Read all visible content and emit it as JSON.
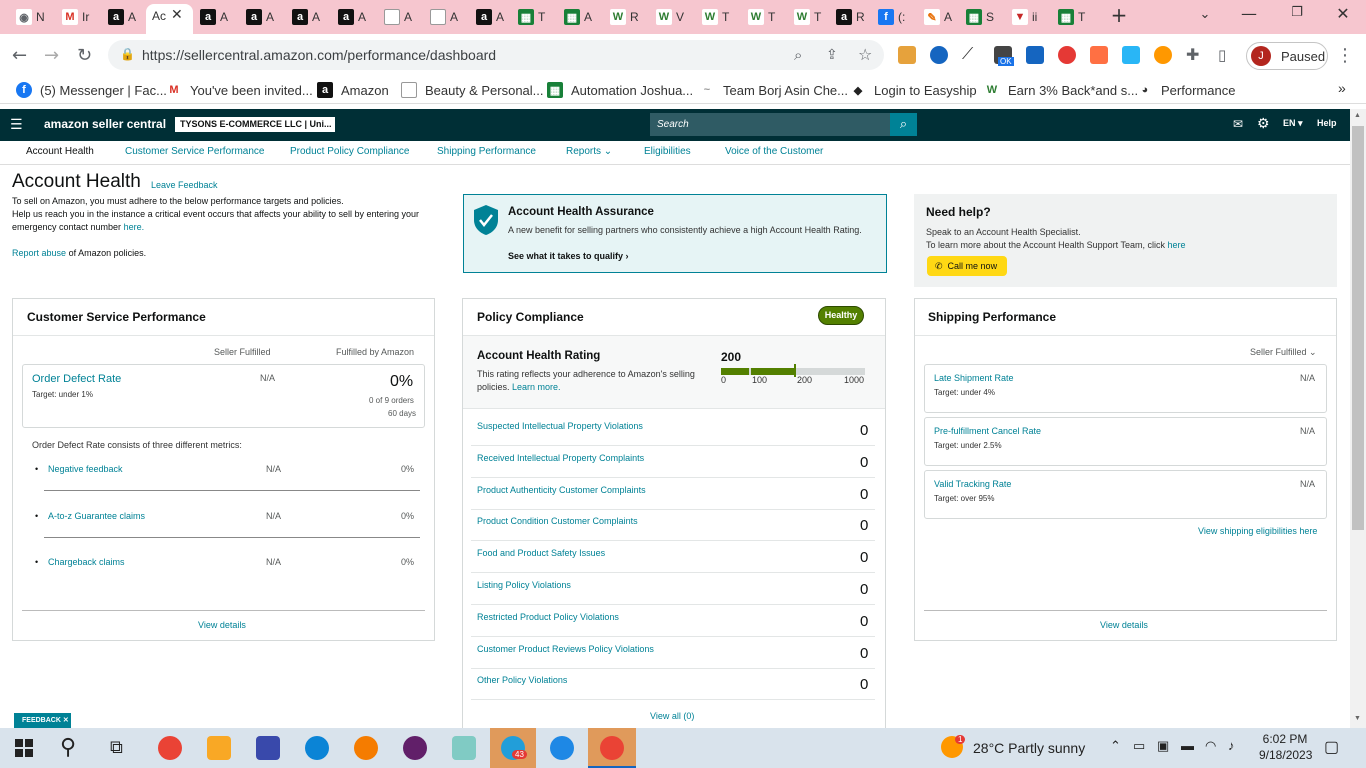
{
  "browser": {
    "tabs": [
      {
        "icon_name": "chrome-icon",
        "label": "N",
        "color": "#5f6368"
      },
      {
        "icon_name": "gmail-icon",
        "label": "Ir",
        "color": "#d93025"
      },
      {
        "icon_name": "amazon-icon",
        "label": "A",
        "color": "#111111"
      },
      {
        "icon_name": "amazon-icon",
        "label": "A",
        "color": "#111111"
      },
      {
        "icon_name": "amazon-icon",
        "label": "A",
        "color": "#111111"
      },
      {
        "icon_name": "amazon-icon",
        "label": "A",
        "color": "#111111"
      },
      {
        "icon_name": "amazon-icon",
        "label": "A",
        "color": "#111111"
      },
      {
        "icon_name": "amazon-smile-icon",
        "label": "A",
        "color": "#ffffff"
      },
      {
        "icon_name": "amazon-smile-icon",
        "label": "A",
        "color": "#ffffff"
      },
      {
        "icon_name": "amazon-icon",
        "label": "A",
        "color": "#111111"
      },
      {
        "icon_name": "sheets-icon",
        "label": "T",
        "color": "#188038"
      },
      {
        "icon_name": "sheets-icon",
        "label": "A",
        "color": "#188038"
      },
      {
        "icon_name": "wish-icon",
        "label": "R",
        "color": "#2e7d32"
      },
      {
        "icon_name": "wish-icon",
        "label": "V",
        "color": "#2e7d32"
      },
      {
        "icon_name": "wish-icon",
        "label": "T",
        "color": "#2e7d32"
      },
      {
        "icon_name": "wish-icon",
        "label": "T",
        "color": "#2e7d32"
      },
      {
        "icon_name": "wish-icon",
        "label": "T",
        "color": "#2e7d32"
      },
      {
        "icon_name": "amazon-icon",
        "label": "R",
        "color": "#111111"
      },
      {
        "icon_name": "facebook-icon",
        "label": "(:",
        "color": "#1877f2"
      },
      {
        "icon_name": "pen-icon",
        "label": "A",
        "color": "#e8710a"
      },
      {
        "icon_name": "sheets-icon",
        "label": "S",
        "color": "#188038"
      },
      {
        "icon_name": "v-icon",
        "label": "ii",
        "color": "#c62828"
      },
      {
        "icon_name": "sheets-icon",
        "label": "T",
        "color": "#188038"
      }
    ],
    "active_tab_label": "Ac",
    "url": "https://sellercentral.amazon.com/performance/dashboard",
    "profile_initial": "J",
    "profile_status": "Paused",
    "ext_badge": "OK",
    "bookmarks": [
      {
        "icon_name": "facebook-icon",
        "label": "(5) Messenger | Fac...",
        "color": "#1877f2"
      },
      {
        "icon_name": "gmail-icon",
        "label": "You've been invited...",
        "color": "#d93025"
      },
      {
        "icon_name": "amazon-icon",
        "label": "Amazon",
        "color": "#111111"
      },
      {
        "icon_name": "amazon-smile-icon",
        "label": "Beauty & Personal...",
        "color": "#ffffff"
      },
      {
        "icon_name": "sheets-icon",
        "label": "Automation Joshua...",
        "color": "#188038"
      },
      {
        "icon_name": "signature-icon",
        "label": "Team Borj Asin Che...",
        "color": "#999999"
      },
      {
        "icon_name": "easyship-icon",
        "label": "Login to Easyship",
        "color": "#222222"
      },
      {
        "icon_name": "wish-icon",
        "label": "Earn 3% Back*and s...",
        "color": "#2e7d32"
      },
      {
        "icon_name": "performance-icon",
        "label": "Performance",
        "color": "#333333"
      }
    ]
  },
  "header": {
    "logo_text": "amazon seller central",
    "store_name": "TYSONS E-COMMERCE LLC | Uni...",
    "search_placeholder": "Search",
    "language": "EN",
    "help": "Help"
  },
  "nav": {
    "items": [
      "Account Health",
      "Customer Service Performance",
      "Product Policy Compliance",
      "Shipping Performance",
      "Reports",
      "Eligibilities",
      "Voice of the Customer"
    ]
  },
  "intro": {
    "title": "Account Health",
    "feedback_link": "Leave Feedback",
    "line1": "To sell on Amazon, you must adhere to the below performance targets and policies.",
    "line2": "Help us reach you in the instance a critical event occurs that affects your ability to sell by entering your emergency contact number",
    "here": "here.",
    "report_link": "Report abuse",
    "report_tail": "of Amazon policies."
  },
  "assurance": {
    "title": "Account Health Assurance",
    "body": "A new benefit for selling partners who consistently achieve a high Account Health Rating.",
    "link": "See what it takes to qualify"
  },
  "help_box": {
    "title": "Need help?",
    "line1": "Speak to an Account Health Specialist.",
    "line2": "To learn more about the Account Health Support Team, click",
    "here": "here",
    "button": "Call me now"
  },
  "customer_service": {
    "title": "Customer Service Performance",
    "col1": "Seller Fulfilled",
    "col2": "Fulfilled by Amazon",
    "odr_label": "Order Defect Rate",
    "odr_target": "Target: under 1%",
    "odr_seller": "N/A",
    "odr_fba": "0%",
    "odr_orders": "0 of 9 orders",
    "odr_days": "60 days",
    "metrics_intro": "Order Defect Rate consists of three different metrics:",
    "metrics": [
      {
        "label": "Negative feedback",
        "seller": "N/A",
        "fba": "0%"
      },
      {
        "label": "A-to-z Guarantee claims",
        "seller": "N/A",
        "fba": "0%"
      },
      {
        "label": "Chargeback claims",
        "seller": "N/A",
        "fba": "0%"
      }
    ],
    "view_details": "View details"
  },
  "policy": {
    "title": "Policy Compliance",
    "badge": "Healthy",
    "ahr_title": "Account Health Rating",
    "ahr_desc": "This rating reflects your adherence to Amazon's selling policies.",
    "learn_more": "Learn more.",
    "rating": "200",
    "rating_value": 200,
    "scale": [
      "0",
      "100",
      "200",
      "1000"
    ],
    "rows": [
      {
        "label": "Suspected Intellectual Property Violations",
        "value": "0"
      },
      {
        "label": "Received Intellectual Property Complaints",
        "value": "0"
      },
      {
        "label": "Product Authenticity Customer Complaints",
        "value": "0"
      },
      {
        "label": "Product Condition Customer Complaints",
        "value": "0"
      },
      {
        "label": "Food and Product Safety Issues",
        "value": "0"
      },
      {
        "label": "Listing Policy Violations",
        "value": "0"
      },
      {
        "label": "Restricted Product Policy Violations",
        "value": "0"
      },
      {
        "label": "Customer Product Reviews Policy Violations",
        "value": "0"
      },
      {
        "label": "Other Policy Violations",
        "value": "0"
      }
    ],
    "view_all": "View all (0)"
  },
  "shipping": {
    "title": "Shipping Performance",
    "filter": "Seller Fulfilled",
    "rows": [
      {
        "label": "Late Shipment Rate",
        "target": "Target: under 4%",
        "value": "N/A"
      },
      {
        "label": "Pre-fulfillment Cancel Rate",
        "target": "Target: under 2.5%",
        "value": "N/A"
      },
      {
        "label": "Valid Tracking Rate",
        "target": "Target: over 95%",
        "value": "N/A"
      }
    ],
    "eligibilities_link": "View shipping eligibilities here",
    "view_details": "View details"
  },
  "feedback_tab": "FEEDBACK",
  "taskbar": {
    "weather": "28°C  Partly sunny",
    "time": "6:02 PM",
    "date": "9/18/2023",
    "telegram_badge": "43",
    "weather_badge": "1"
  },
  "colors": {
    "header_bg": "#002f36",
    "teal_link": "#008296",
    "healthy_green": "#538000",
    "call_button": "#ffd814"
  }
}
